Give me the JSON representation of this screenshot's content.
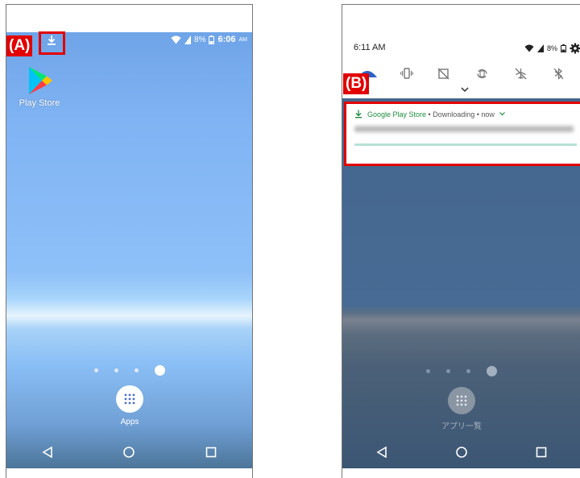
{
  "panelA": {
    "callout": "(A)",
    "status": {
      "battery_pct": "8%",
      "time": "6:06",
      "ampm": "AM"
    },
    "app_icon_label": "Play Store",
    "apps_label": "Apps"
  },
  "panelB": {
    "callout": "(B)",
    "status": {
      "time": "6:11 AM",
      "battery_pct": "8%"
    },
    "notification": {
      "app_name": "Google Play Store",
      "separator1": " • ",
      "state": "Downloading",
      "separator2": " • ",
      "when": "now",
      "progress": 0
    },
    "apps_label": "アプリ一覧"
  },
  "colors": {
    "callout": "#e20000",
    "play_green": "#1e8e3e",
    "progress_track": "#b6e2d6"
  }
}
